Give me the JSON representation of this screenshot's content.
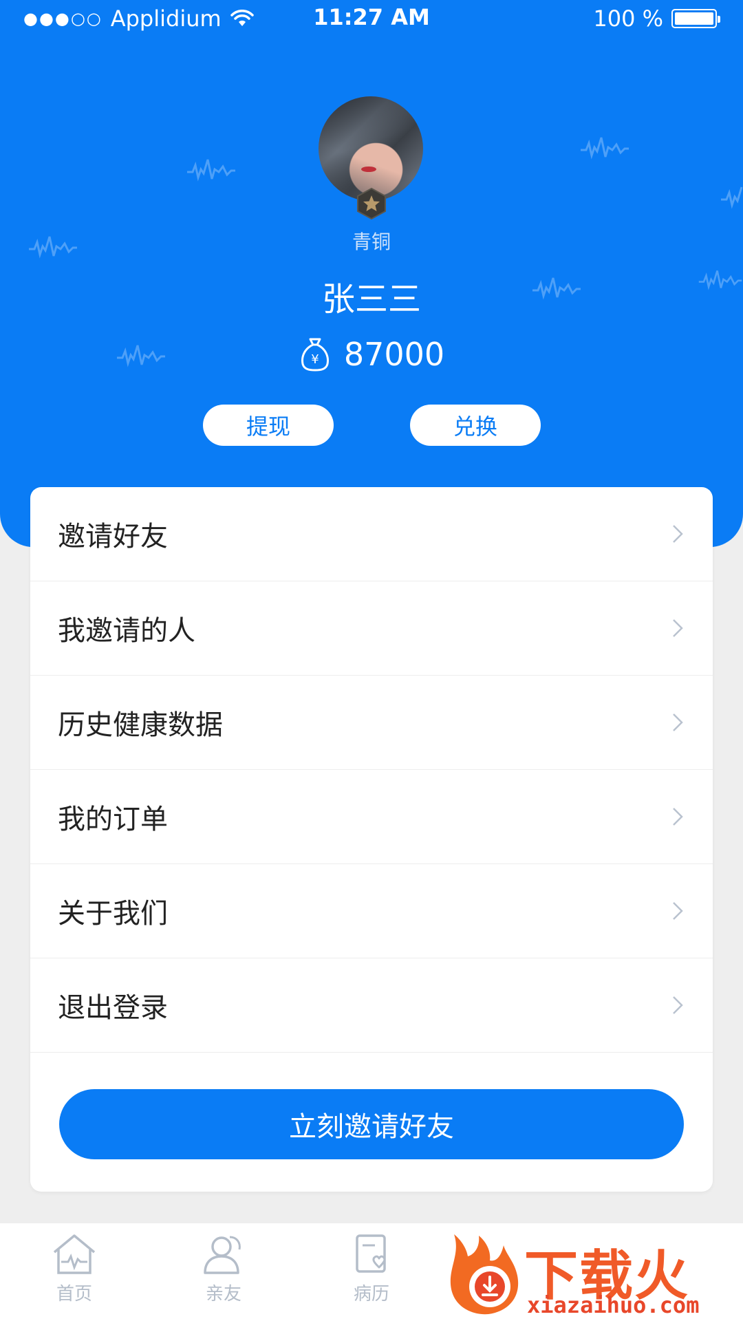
{
  "status_bar": {
    "carrier": "Applidium",
    "time": "11:27 AM",
    "battery": "100 %"
  },
  "profile": {
    "level": "青铜",
    "name": "张三三",
    "coins": "87000"
  },
  "actions": {
    "withdraw": "提现",
    "exchange": "兑换"
  },
  "menu": {
    "items": [
      {
        "label": "邀请好友"
      },
      {
        "label": "我邀请的人"
      },
      {
        "label": "历史健康数据"
      },
      {
        "label": "我的订单"
      },
      {
        "label": "关于我们"
      },
      {
        "label": "退出登录"
      }
    ],
    "cta": "立刻邀请好友"
  },
  "tabs": [
    {
      "label": "首页"
    },
    {
      "label": "亲友"
    },
    {
      "label": "病历"
    }
  ],
  "promo": {
    "title": "下载火",
    "url": "xiazaihuo.com"
  },
  "colors": {
    "accent": "#0a7cf5",
    "tab_inactive": "#b4bdc9"
  }
}
